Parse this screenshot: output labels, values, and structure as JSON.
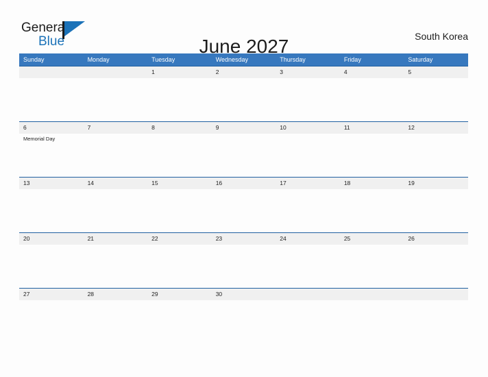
{
  "brand": {
    "name_part1": "General",
    "name_part2": "Blue",
    "flag_icon": "flag-icon",
    "accent_color": "#1b72b8"
  },
  "header": {
    "title": "June 2027",
    "country": "South Korea"
  },
  "colors": {
    "header_blue": "#3778be",
    "row_divider": "#1f5fa0",
    "date_band_gray": "#f0f0f0",
    "page_background": "#fdfdfd",
    "text": "#222222"
  },
  "calendar": {
    "weekdays": [
      "Sunday",
      "Monday",
      "Tuesday",
      "Wednesday",
      "Thursday",
      "Friday",
      "Saturday"
    ],
    "weeks": [
      {
        "days": [
          {
            "date": "",
            "events": []
          },
          {
            "date": "",
            "events": []
          },
          {
            "date": "1",
            "events": []
          },
          {
            "date": "2",
            "events": []
          },
          {
            "date": "3",
            "events": []
          },
          {
            "date": "4",
            "events": []
          },
          {
            "date": "5",
            "events": []
          }
        ]
      },
      {
        "days": [
          {
            "date": "6",
            "events": [
              "Memorial Day"
            ]
          },
          {
            "date": "7",
            "events": []
          },
          {
            "date": "8",
            "events": []
          },
          {
            "date": "9",
            "events": []
          },
          {
            "date": "10",
            "events": []
          },
          {
            "date": "11",
            "events": []
          },
          {
            "date": "12",
            "events": []
          }
        ]
      },
      {
        "days": [
          {
            "date": "13",
            "events": []
          },
          {
            "date": "14",
            "events": []
          },
          {
            "date": "15",
            "events": []
          },
          {
            "date": "16",
            "events": []
          },
          {
            "date": "17",
            "events": []
          },
          {
            "date": "18",
            "events": []
          },
          {
            "date": "19",
            "events": []
          }
        ]
      },
      {
        "days": [
          {
            "date": "20",
            "events": []
          },
          {
            "date": "21",
            "events": []
          },
          {
            "date": "22",
            "events": []
          },
          {
            "date": "23",
            "events": []
          },
          {
            "date": "24",
            "events": []
          },
          {
            "date": "25",
            "events": []
          },
          {
            "date": "26",
            "events": []
          }
        ]
      },
      {
        "days": [
          {
            "date": "27",
            "events": []
          },
          {
            "date": "28",
            "events": []
          },
          {
            "date": "29",
            "events": []
          },
          {
            "date": "30",
            "events": []
          },
          {
            "date": "",
            "events": []
          },
          {
            "date": "",
            "events": []
          },
          {
            "date": "",
            "events": []
          }
        ]
      }
    ]
  }
}
